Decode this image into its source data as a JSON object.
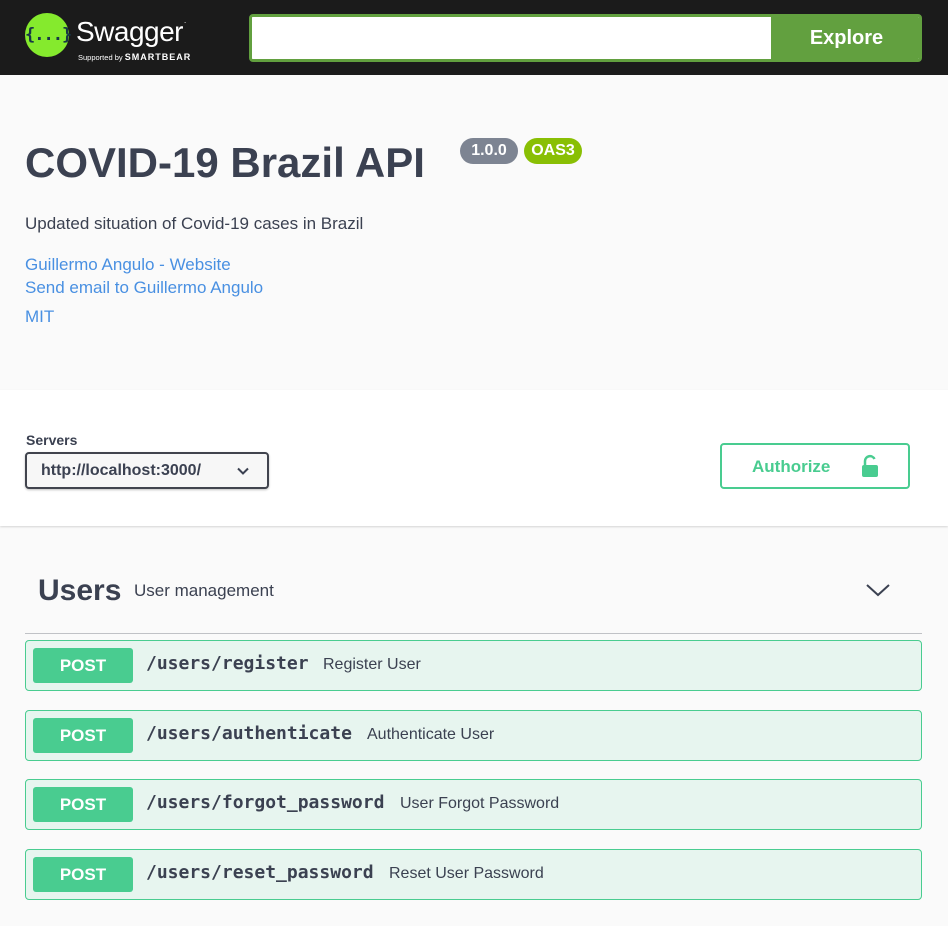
{
  "topbar": {
    "logo_symbol": "{...}",
    "logo_word": "Swagger",
    "logo_tm": ".",
    "logo_sub_prefix": "Supported by",
    "logo_sub_brand": "SMARTBEAR",
    "explore_input_value": "",
    "explore_label": "Explore",
    "colors": {
      "bar": "#1b1b1b",
      "accent": "#62a03f",
      "logo": "#85ea2d"
    }
  },
  "info": {
    "title": "COVID-19 Brazil API",
    "version": "1.0.0",
    "oas": "OAS3",
    "description": "Updated situation of Covid-19 cases in Brazil",
    "links": {
      "website": "Guillermo Angulo - Website",
      "email": "Send email to Guillermo Angulo",
      "license": "MIT"
    }
  },
  "scheme": {
    "servers_label": "Servers",
    "selected_server": "http://localhost:3000/",
    "authorize_label": "Authorize"
  },
  "tag": {
    "name": "Users",
    "description": "User management",
    "operations": [
      {
        "method": "POST",
        "path": "/users/register",
        "summary": "Register User"
      },
      {
        "method": "POST",
        "path": "/users/authenticate",
        "summary": "Authenticate User"
      },
      {
        "method": "POST",
        "path": "/users/forgot_password",
        "summary": "User Forgot Password"
      },
      {
        "method": "POST",
        "path": "/users/reset_password",
        "summary": "Reset User Password"
      }
    ]
  },
  "icons": [
    "swagger-logo-icon",
    "chevron-down-icon",
    "lock-icon"
  ],
  "colors": {
    "post": "#49cc90",
    "link": "#4990e2",
    "version_badge": "#7d8492",
    "oas_badge": "#89bf04"
  }
}
